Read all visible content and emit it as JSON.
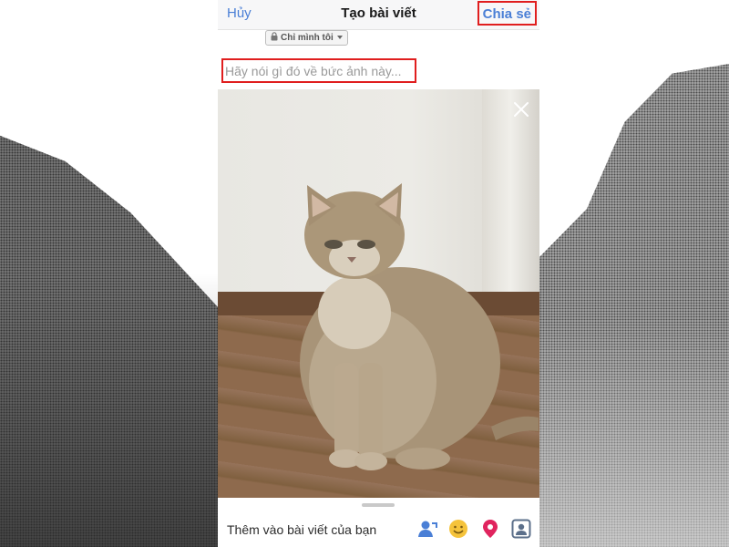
{
  "header": {
    "cancel_label": "Hủy",
    "title": "Tạo bài viết",
    "share_label": "Chia sẻ"
  },
  "privacy": {
    "label": "Chỉ mình tôi",
    "icon": "lock-icon"
  },
  "composer": {
    "placeholder": "Hãy nói gì đó về bức ảnh này..."
  },
  "photo": {
    "subject": "cat-photo",
    "close_icon": "close-icon"
  },
  "footer": {
    "add_label": "Thêm vào bài viết của bạn",
    "icons": [
      "tag-friends-icon",
      "feeling-emoji-icon",
      "location-pin-icon",
      "contact-tag-icon"
    ]
  },
  "colors": {
    "accent": "#4a7fd6",
    "highlight": "#e01e1e",
    "emoji": "#f5c33b",
    "location": "#e0245e"
  }
}
